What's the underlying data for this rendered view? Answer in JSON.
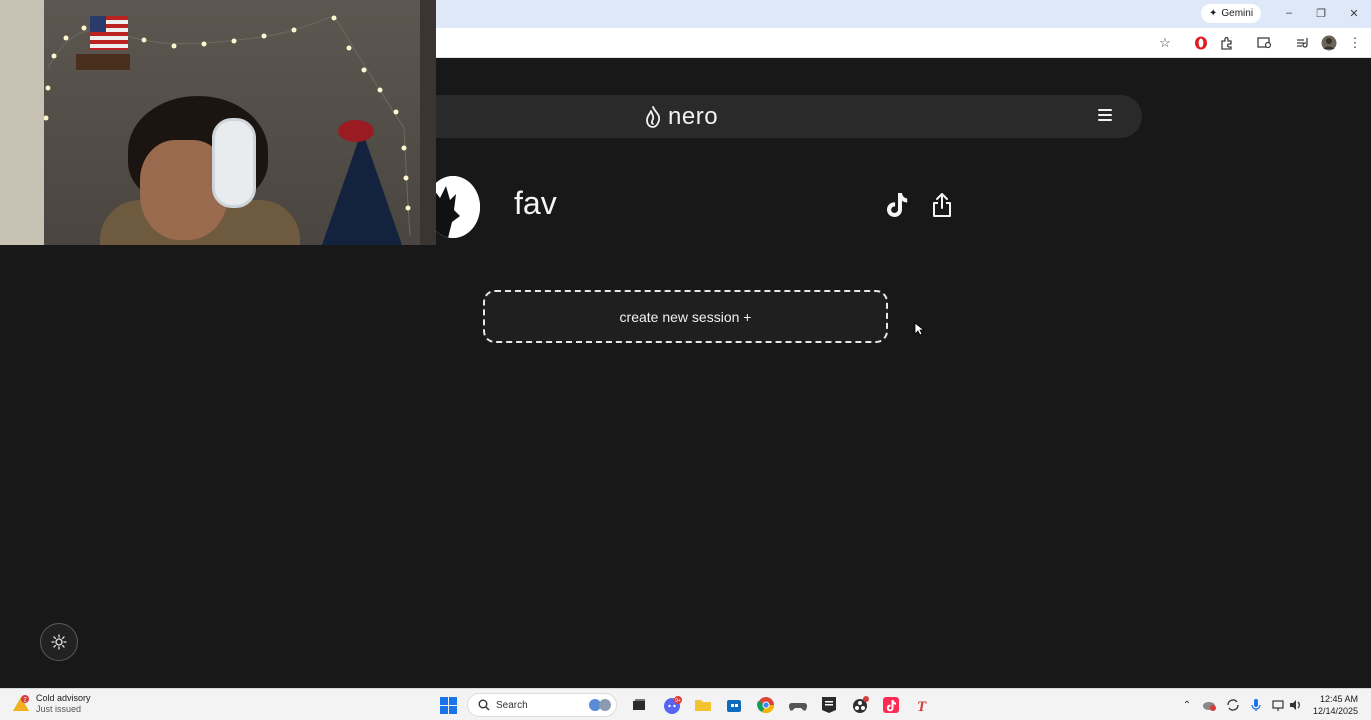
{
  "browser": {
    "gemini_label": "Gemini",
    "window_controls": [
      "minimize",
      "restore",
      "close"
    ]
  },
  "app": {
    "logo_text": "nero",
    "profile_name": "fav",
    "create_session_label": "create new session +"
  },
  "taskbar": {
    "weather_title": "Cold advisory",
    "weather_sub": "Just issued",
    "weather_badge": "2",
    "search_placeholder": "Search",
    "chat_badge": "9+",
    "time": "12:45 AM",
    "date": "12/14/2025"
  },
  "colors": {
    "page_bg": "#181818",
    "navbar_bg": "#2a2a2a",
    "accent_taskbar": "#1a73e8"
  }
}
